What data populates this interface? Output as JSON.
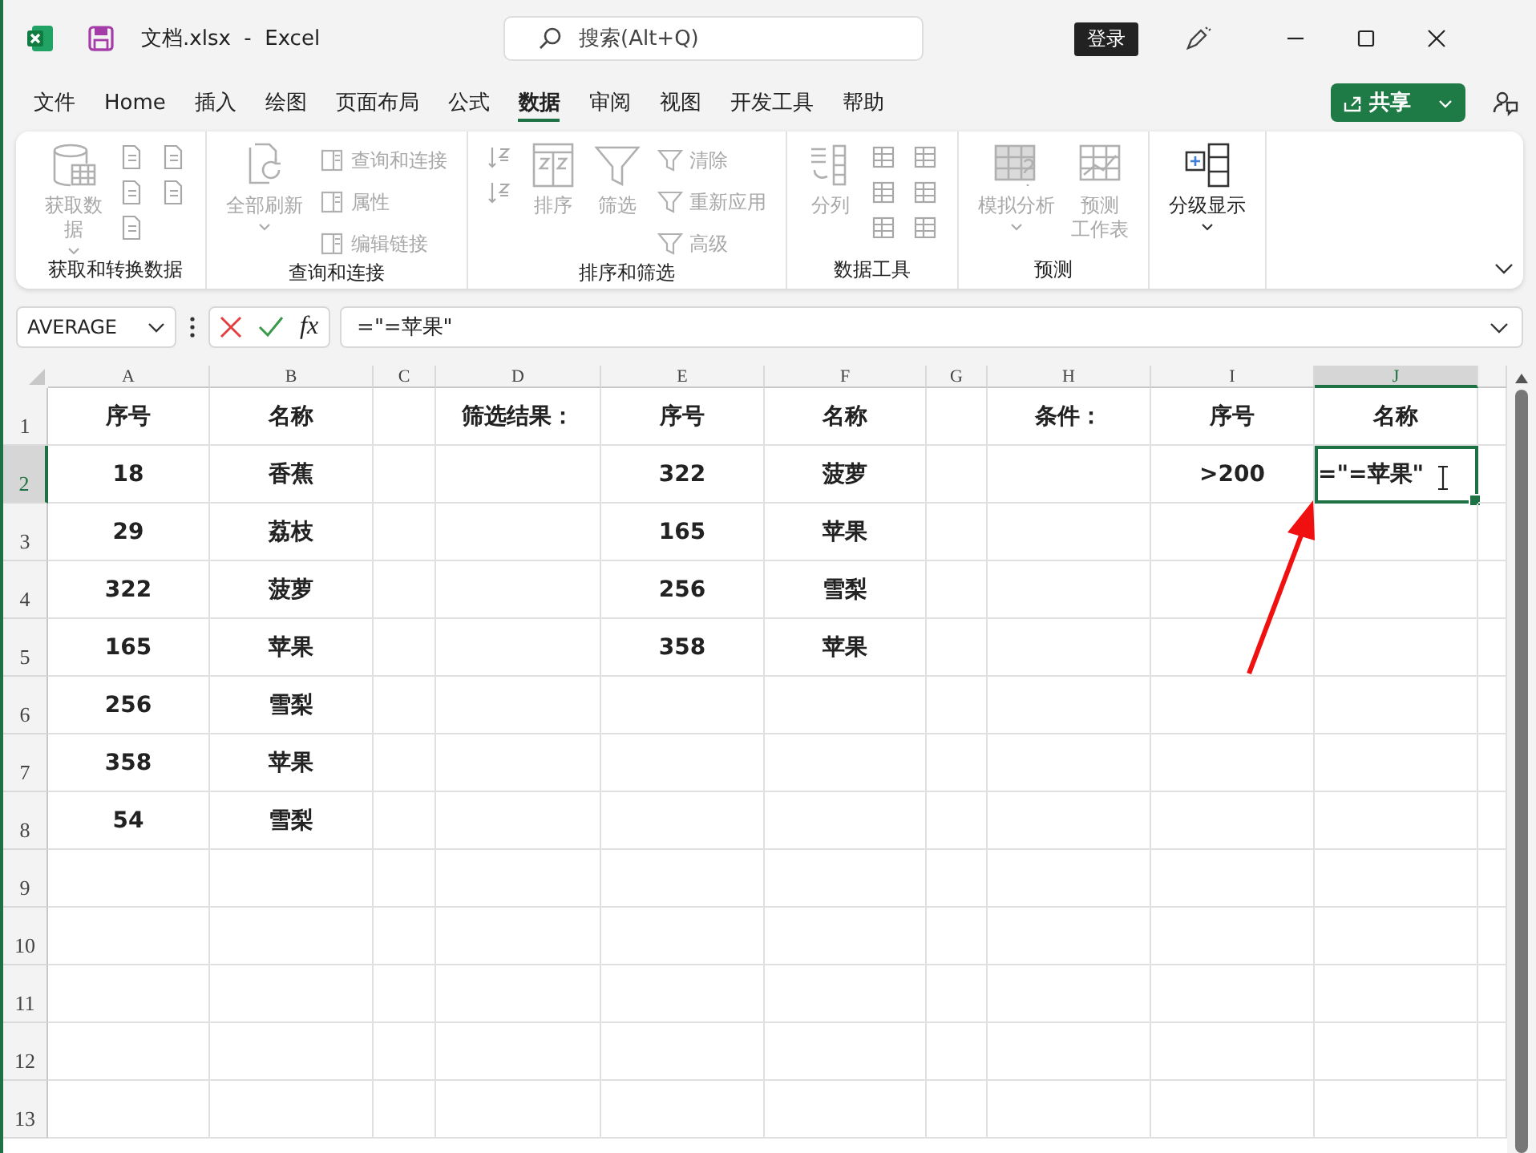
{
  "window": {
    "title": "文档.xlsx  -  Excel",
    "search": {
      "placeholder": "搜索(Alt+Q)"
    },
    "login_button": "登录"
  },
  "menu_tabs": [
    {
      "label": "文件",
      "selected": false
    },
    {
      "label": "Home",
      "selected": false
    },
    {
      "label": "插入",
      "selected": false
    },
    {
      "label": "绘图",
      "selected": false
    },
    {
      "label": "页面布局",
      "selected": false
    },
    {
      "label": "公式",
      "selected": false
    },
    {
      "label": "数据",
      "selected": true
    },
    {
      "label": "审阅",
      "selected": false
    },
    {
      "label": "视图",
      "selected": false
    },
    {
      "label": "开发工具",
      "selected": false
    },
    {
      "label": "帮助",
      "selected": false
    }
  ],
  "share_button": "共享",
  "ribbon": {
    "groups": [
      {
        "label": "获取和转换数据",
        "columns": [
          [
            {
              "kind": "large",
              "lines": [
                "获取数",
                "据"
              ],
              "dropdown": true,
              "disabled": true
            }
          ],
          [
            {
              "kind": "icon",
              "disabled": true
            },
            {
              "kind": "icon",
              "disabled": true
            },
            {
              "kind": "icon",
              "disabled": true
            }
          ],
          [
            {
              "kind": "icon",
              "disabled": true
            },
            {
              "kind": "icon",
              "disabled": true
            }
          ]
        ]
      },
      {
        "label": "查询和连接",
        "columns": [
          [
            {
              "kind": "large",
              "lines": [
                "全部刷新"
              ],
              "dropdown": true,
              "disabled": true
            }
          ],
          [
            {
              "kind": "small",
              "text": "查询和连接",
              "disabled": true
            },
            {
              "kind": "small",
              "text": "属性",
              "disabled": true
            },
            {
              "kind": "small",
              "text": "编辑链接",
              "disabled": true
            }
          ]
        ]
      },
      {
        "label": "排序和筛选",
        "columns": [
          [
            {
              "kind": "icon",
              "disabled": true
            },
            {
              "kind": "icon",
              "disabled": true
            }
          ],
          [
            {
              "kind": "large",
              "lines": [
                "排序"
              ],
              "dropdown": false,
              "disabled": true
            }
          ],
          [
            {
              "kind": "large",
              "lines": [
                "筛选"
              ],
              "dropdown": false,
              "disabled": true
            }
          ],
          [
            {
              "kind": "small",
              "text": "清除",
              "disabled": true
            },
            {
              "kind": "small",
              "text": "重新应用",
              "disabled": true
            },
            {
              "kind": "small",
              "text": "高级",
              "disabled": true
            }
          ]
        ]
      },
      {
        "label": "数据工具",
        "columns": [
          [
            {
              "kind": "large",
              "lines": [
                "分列"
              ],
              "dropdown": false,
              "disabled": true
            }
          ],
          [
            {
              "kind": "icon",
              "disabled": true
            },
            {
              "kind": "icon",
              "disabled": true
            },
            {
              "kind": "icon",
              "disabled": true
            }
          ],
          [
            {
              "kind": "icon",
              "disabled": true
            },
            {
              "kind": "icon",
              "disabled": true
            },
            {
              "kind": "icon",
              "disabled": true
            }
          ]
        ]
      },
      {
        "label": "预测",
        "columns": [
          [
            {
              "kind": "large",
              "lines": [
                "模拟分析"
              ],
              "dropdown": true,
              "disabled": true
            }
          ],
          [
            {
              "kind": "large",
              "lines": [
                "预测",
                "工作表"
              ],
              "dropdown": false,
              "disabled": true
            }
          ]
        ]
      },
      {
        "columns": [
          [
            {
              "kind": "large",
              "lines": [
                "分级显示"
              ],
              "dropdown": true,
              "disabled": false
            }
          ]
        ]
      }
    ]
  },
  "formula_bar": {
    "name_box": "AVERAGE",
    "fx": "fx",
    "formula": "=\"=苹果\""
  },
  "sheet": {
    "columns": [
      {
        "label": "A",
        "selected": false
      },
      {
        "label": "B",
        "selected": false
      },
      {
        "label": "C",
        "selected": false
      },
      {
        "label": "D",
        "selected": false
      },
      {
        "label": "E",
        "selected": false
      },
      {
        "label": "F",
        "selected": false
      },
      {
        "label": "G",
        "selected": false
      },
      {
        "label": "H",
        "selected": false
      },
      {
        "label": "I",
        "selected": false
      },
      {
        "label": "J",
        "selected": true
      }
    ],
    "rows": [
      {
        "label": "1",
        "selected": false,
        "cells": [
          {
            "text": "序号",
            "active": false
          },
          {
            "text": "名称",
            "active": false
          },
          null,
          {
            "text": "筛选结果：",
            "active": false
          },
          {
            "text": "序号",
            "active": false
          },
          {
            "text": "名称",
            "active": false
          },
          null,
          {
            "text": "条件：",
            "active": false
          },
          {
            "text": "序号",
            "active": false
          },
          {
            "text": "名称",
            "active": false
          }
        ]
      },
      {
        "label": "2",
        "selected": true,
        "cells": [
          {
            "text": "18",
            "active": false
          },
          {
            "text": "香蕉",
            "active": false
          },
          null,
          null,
          {
            "text": "322",
            "active": false
          },
          {
            "text": "菠萝",
            "active": false
          },
          null,
          null,
          {
            "text": ">200",
            "active": false
          },
          {
            "text": "=\"=苹果\"",
            "active": true
          }
        ]
      },
      {
        "label": "3",
        "selected": false,
        "cells": [
          {
            "text": "29",
            "active": false
          },
          {
            "text": "荔枝",
            "active": false
          },
          null,
          null,
          {
            "text": "165",
            "active": false
          },
          {
            "text": "苹果",
            "active": false
          }
        ]
      },
      {
        "label": "4",
        "selected": false,
        "cells": [
          {
            "text": "322",
            "active": false
          },
          {
            "text": "菠萝",
            "active": false
          },
          null,
          null,
          {
            "text": "256",
            "active": false
          },
          {
            "text": "雪梨",
            "active": false
          }
        ]
      },
      {
        "label": "5",
        "selected": false,
        "cells": [
          {
            "text": "165",
            "active": false
          },
          {
            "text": "苹果",
            "active": false
          },
          null,
          null,
          {
            "text": "358",
            "active": false
          },
          {
            "text": "苹果",
            "active": false
          }
        ]
      },
      {
        "label": "6",
        "selected": false,
        "cells": [
          {
            "text": "256",
            "active": false
          },
          {
            "text": "雪梨",
            "active": false
          }
        ]
      },
      {
        "label": "7",
        "selected": false,
        "cells": [
          {
            "text": "358",
            "active": false
          },
          {
            "text": "苹果",
            "active": false
          }
        ]
      },
      {
        "label": "8",
        "selected": false,
        "cells": [
          {
            "text": "54",
            "active": false
          },
          {
            "text": "雪梨",
            "active": false
          }
        ]
      },
      {
        "label": "9",
        "selected": false
      },
      {
        "label": "10",
        "selected": false
      },
      {
        "label": "11",
        "selected": false
      },
      {
        "label": "12",
        "selected": false
      },
      {
        "label": "13",
        "selected": false
      }
    ]
  }
}
